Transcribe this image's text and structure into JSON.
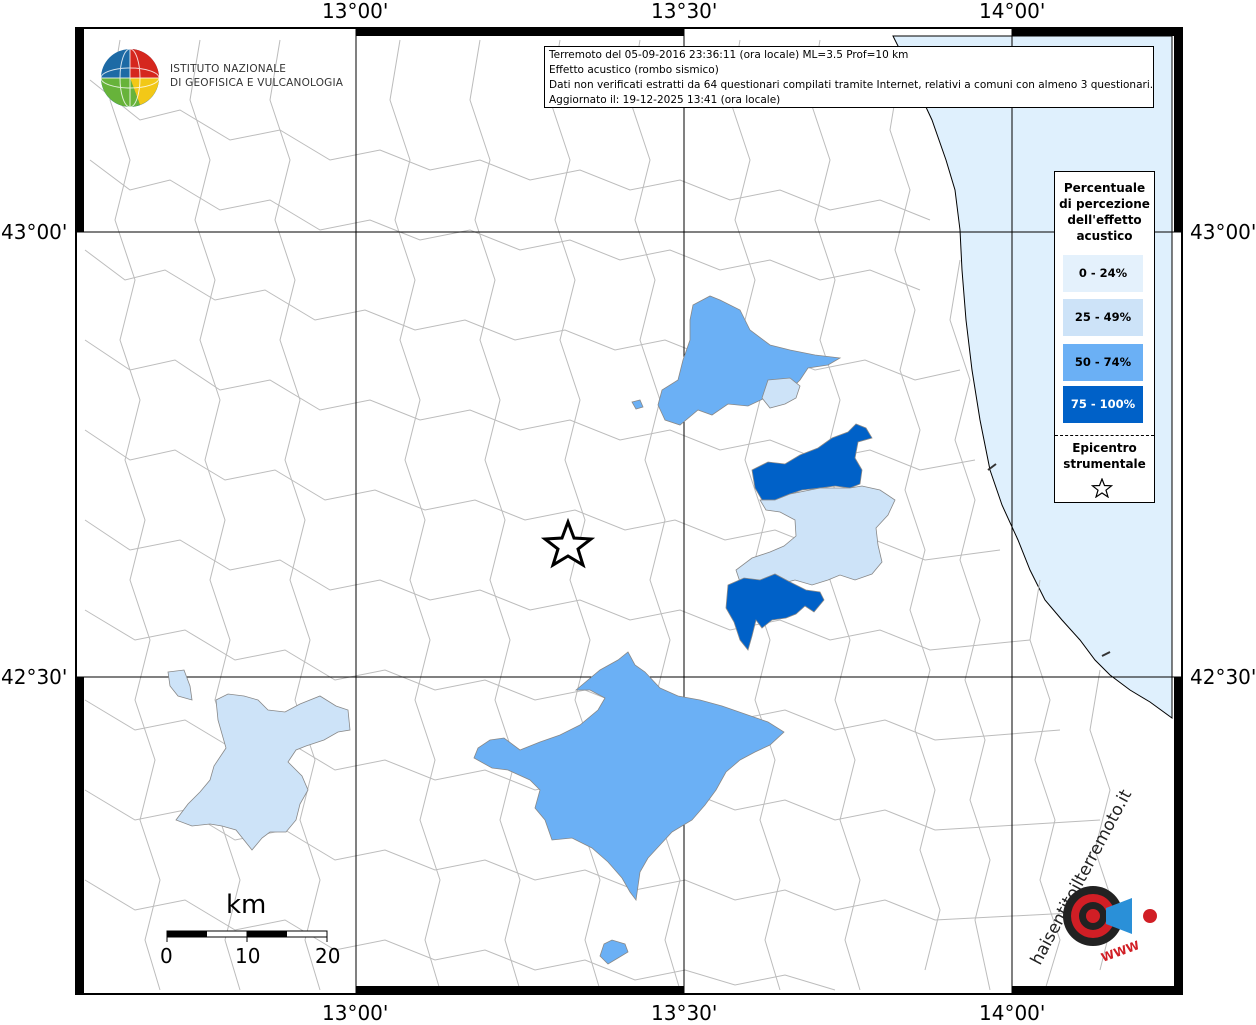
{
  "institute": {
    "name_line1": "ISTITUTO NAZIONALE",
    "name_line2": "DI GEOFISICA E VULCANOLOGIA"
  },
  "info": {
    "line1": "Terremoto del 05-09-2016 23:36:11 (ora locale) ML=3.5 Prof=10 km",
    "line2": "Effetto acustico (rombo sismico)",
    "line3": "Dati non verificati estratti da 64 questionari compilati tramite Internet, relativi a comuni con almeno 3 questionari.",
    "line4": "Aggiornato il: 19-12-2025 13:41 (ora locale)"
  },
  "axes": {
    "lon_labels": [
      "13°00'",
      "13°30'",
      "14°00'"
    ],
    "lat_labels": [
      "43°00'",
      "42°30'"
    ]
  },
  "legend": {
    "title_lines": [
      "Percentuale",
      "di percezione",
      "dell'effetto",
      "acustico"
    ],
    "classes": [
      {
        "label": "0 - 24%",
        "color": "#e4f1fc",
        "text_color": "#000000"
      },
      {
        "label": "25 - 49%",
        "color": "#cde3f8",
        "text_color": "#000000"
      },
      {
        "label": "50 - 74%",
        "color": "#6bb0f5",
        "text_color": "#000000"
      },
      {
        "label": "75 - 100%",
        "color": "#0061c8",
        "text_color": "#ffffff"
      }
    ],
    "epicenter_lines": [
      "Epicentro",
      "strumentale"
    ]
  },
  "scale_bar": {
    "unit": "km",
    "ticks": [
      "0",
      "10",
      "20"
    ]
  },
  "colors": {
    "sea": "#dff0fd",
    "border": "#b8b8b8",
    "grid": "#000000"
  },
  "watermark": {
    "text": "haisentitoilterremoto.it",
    "site": "WWW"
  }
}
